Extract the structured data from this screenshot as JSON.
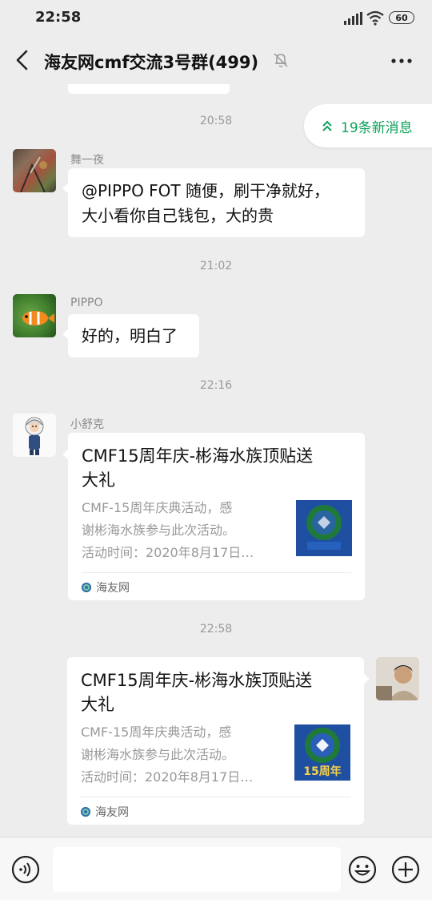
{
  "status_bar": {
    "time": "22:58",
    "battery": "60"
  },
  "header": {
    "title": "海友网cmf交流3号群(499)"
  },
  "new_messages": {
    "label": "19条新消息"
  },
  "timestamps": [
    "20:58",
    "21:02",
    "22:16",
    "22:58"
  ],
  "messages": [
    {
      "sender": "舞一夜",
      "lines": [
        "@PIPPO FOT 随便，刷干净就好，",
        "大小看你自己钱包，大的贵"
      ]
    },
    {
      "sender": "PIPPO",
      "lines": [
        "好的，明白了"
      ]
    },
    {
      "sender": "小舒克",
      "card": {
        "title_lines": [
          "CMF15周年庆-彬海水族顶贴送",
          "大礼"
        ],
        "desc_lines": [
          "CMF-15周年庆典活动，感",
          "谢彬海水族参与此次活动。",
          "活动时间：2020年8月17日…"
        ],
        "source": "海友网"
      }
    },
    {
      "sender": "",
      "card": {
        "title_lines": [
          "CMF15周年庆-彬海水族顶贴送",
          "大礼"
        ],
        "desc_lines": [
          "CMF-15周年庆典活动，感",
          "谢彬海水族参与此次活动。",
          "活动时间：2020年8月17日…"
        ],
        "source": "海友网",
        "thumb_text": "15周年"
      }
    }
  ],
  "colors": {
    "accent_green": "#0ea05a",
    "background": "#ededed",
    "thumb_blue": "#1f4fa0",
    "thumb_green": "#1f7a3a"
  },
  "icons": [
    "back-arrow-icon",
    "mute-bell-icon",
    "more-dots-icon",
    "double-chevron-up-icon",
    "voice-icon",
    "emoji-icon",
    "plus-icon",
    "signal-icon",
    "wifi-icon"
  ]
}
